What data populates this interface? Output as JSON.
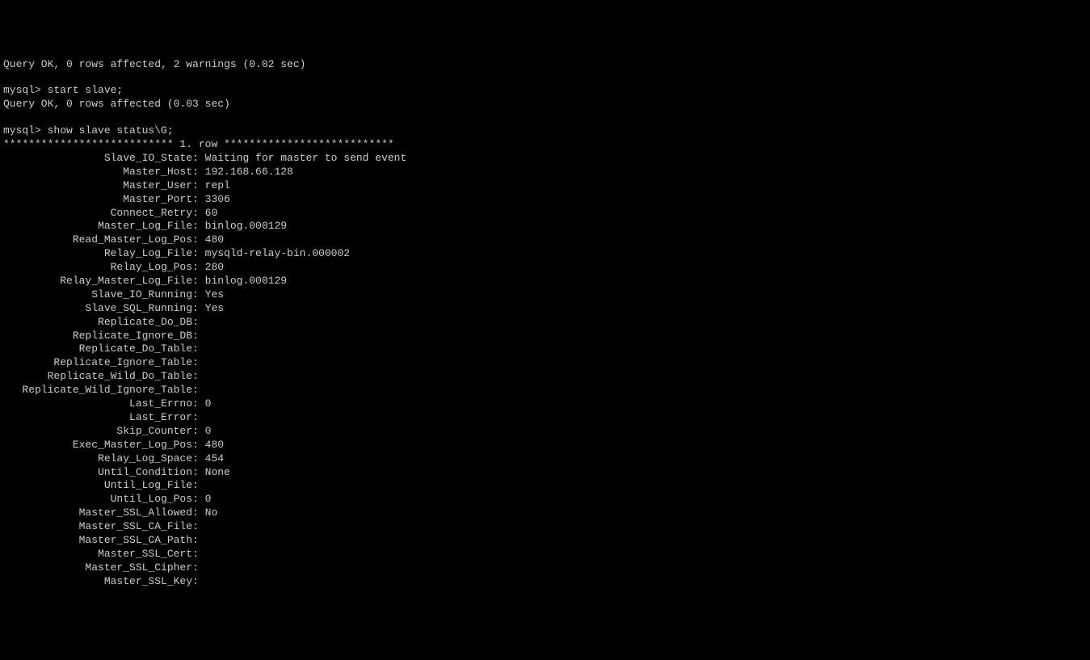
{
  "lines": [
    "Query OK, 0 rows affected, 2 warnings (0.02 sec)",
    "",
    "mysql> start slave;",
    "Query OK, 0 rows affected (0.03 sec)",
    "",
    "mysql> show slave status\\G;",
    "*************************** 1. row ***************************"
  ],
  "status": [
    {
      "label": "Slave_IO_State",
      "value": "Waiting for master to send event"
    },
    {
      "label": "Master_Host",
      "value": "192.168.66.128"
    },
    {
      "label": "Master_User",
      "value": "repl"
    },
    {
      "label": "Master_Port",
      "value": "3306"
    },
    {
      "label": "Connect_Retry",
      "value": "60"
    },
    {
      "label": "Master_Log_File",
      "value": "binlog.000129"
    },
    {
      "label": "Read_Master_Log_Pos",
      "value": "480"
    },
    {
      "label": "Relay_Log_File",
      "value": "mysqld-relay-bin.000002"
    },
    {
      "label": "Relay_Log_Pos",
      "value": "280"
    },
    {
      "label": "Relay_Master_Log_File",
      "value": "binlog.000129"
    },
    {
      "label": "Slave_IO_Running",
      "value": "Yes"
    },
    {
      "label": "Slave_SQL_Running",
      "value": "Yes"
    },
    {
      "label": "Replicate_Do_DB",
      "value": ""
    },
    {
      "label": "Replicate_Ignore_DB",
      "value": ""
    },
    {
      "label": "Replicate_Do_Table",
      "value": ""
    },
    {
      "label": "Replicate_Ignore_Table",
      "value": ""
    },
    {
      "label": "Replicate_Wild_Do_Table",
      "value": ""
    },
    {
      "label": "Replicate_Wild_Ignore_Table",
      "value": ""
    },
    {
      "label": "Last_Errno",
      "value": "0"
    },
    {
      "label": "Last_Error",
      "value": ""
    },
    {
      "label": "Skip_Counter",
      "value": "0"
    },
    {
      "label": "Exec_Master_Log_Pos",
      "value": "480"
    },
    {
      "label": "Relay_Log_Space",
      "value": "454"
    },
    {
      "label": "Until_Condition",
      "value": "None"
    },
    {
      "label": "Until_Log_File",
      "value": ""
    },
    {
      "label": "Until_Log_Pos",
      "value": "0"
    },
    {
      "label": "Master_SSL_Allowed",
      "value": "No"
    },
    {
      "label": "Master_SSL_CA_File",
      "value": ""
    },
    {
      "label": "Master_SSL_CA_Path",
      "value": ""
    },
    {
      "label": "Master_SSL_Cert",
      "value": ""
    },
    {
      "label": "Master_SSL_Cipher",
      "value": ""
    },
    {
      "label": "Master_SSL_Key",
      "value": ""
    }
  ]
}
